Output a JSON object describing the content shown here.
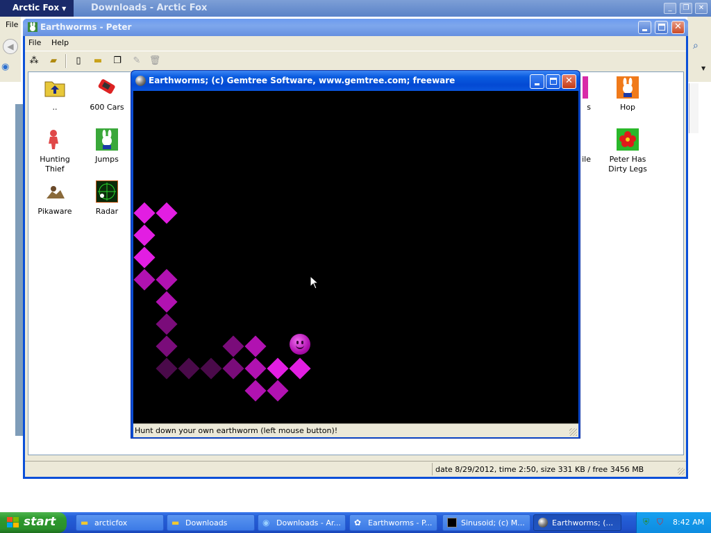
{
  "browser": {
    "menu_button": "Arctic Fox",
    "title": "Downloads - Arctic Fox",
    "file_menu": "File"
  },
  "explorer": {
    "title": "Earthworms - Peter",
    "menu": [
      "File",
      "Help"
    ],
    "items": [
      {
        "label": "..",
        "icon": "folder-up-icon"
      },
      {
        "label": "600 Cars",
        "icon": "car-icon"
      },
      {
        "label": "Hunting Thief",
        "icon": "thief-icon"
      },
      {
        "label": "Jumps",
        "icon": "bunny-icon"
      },
      {
        "label": "Pikaware",
        "icon": "pikaware-icon"
      },
      {
        "label": "Radar",
        "icon": "radar-icon"
      },
      {
        "label": "s",
        "icon": "partial-icon"
      },
      {
        "label": "Hop",
        "icon": "bunny-icon"
      },
      {
        "label": "ile",
        "icon": "partial-icon"
      },
      {
        "label": "Peter Has Dirty Legs",
        "icon": "flower-icon"
      }
    ],
    "status": "date 8/29/2012, time 2:50, size 331 KB / free 3456 MB"
  },
  "game": {
    "title": "Earthworms;   (c) Gemtree Software, www.gemtree.com;   freeware",
    "status": "Hunt down your own earthworm (left mouse button)!",
    "colors": {
      "bright": "#e21ee2",
      "mid": "#b112b1",
      "dim": "#7a0c7a",
      "dark": "#4a0a4a"
    }
  },
  "taskbar": {
    "start": "start",
    "tasks": [
      {
        "label": "arcticfox",
        "icon": "folder-icon"
      },
      {
        "label": "Downloads",
        "icon": "folder-icon"
      },
      {
        "label": "Downloads - Ar...",
        "icon": "browser-icon"
      },
      {
        "label": "Earthworms - P...",
        "icon": "bunny-icon"
      },
      {
        "label": "Sinusoid;  (c) M...",
        "icon": "app-icon"
      },
      {
        "label": "Earthworms;   (...",
        "icon": "ball-icon"
      }
    ],
    "clock": "8:42 AM"
  }
}
